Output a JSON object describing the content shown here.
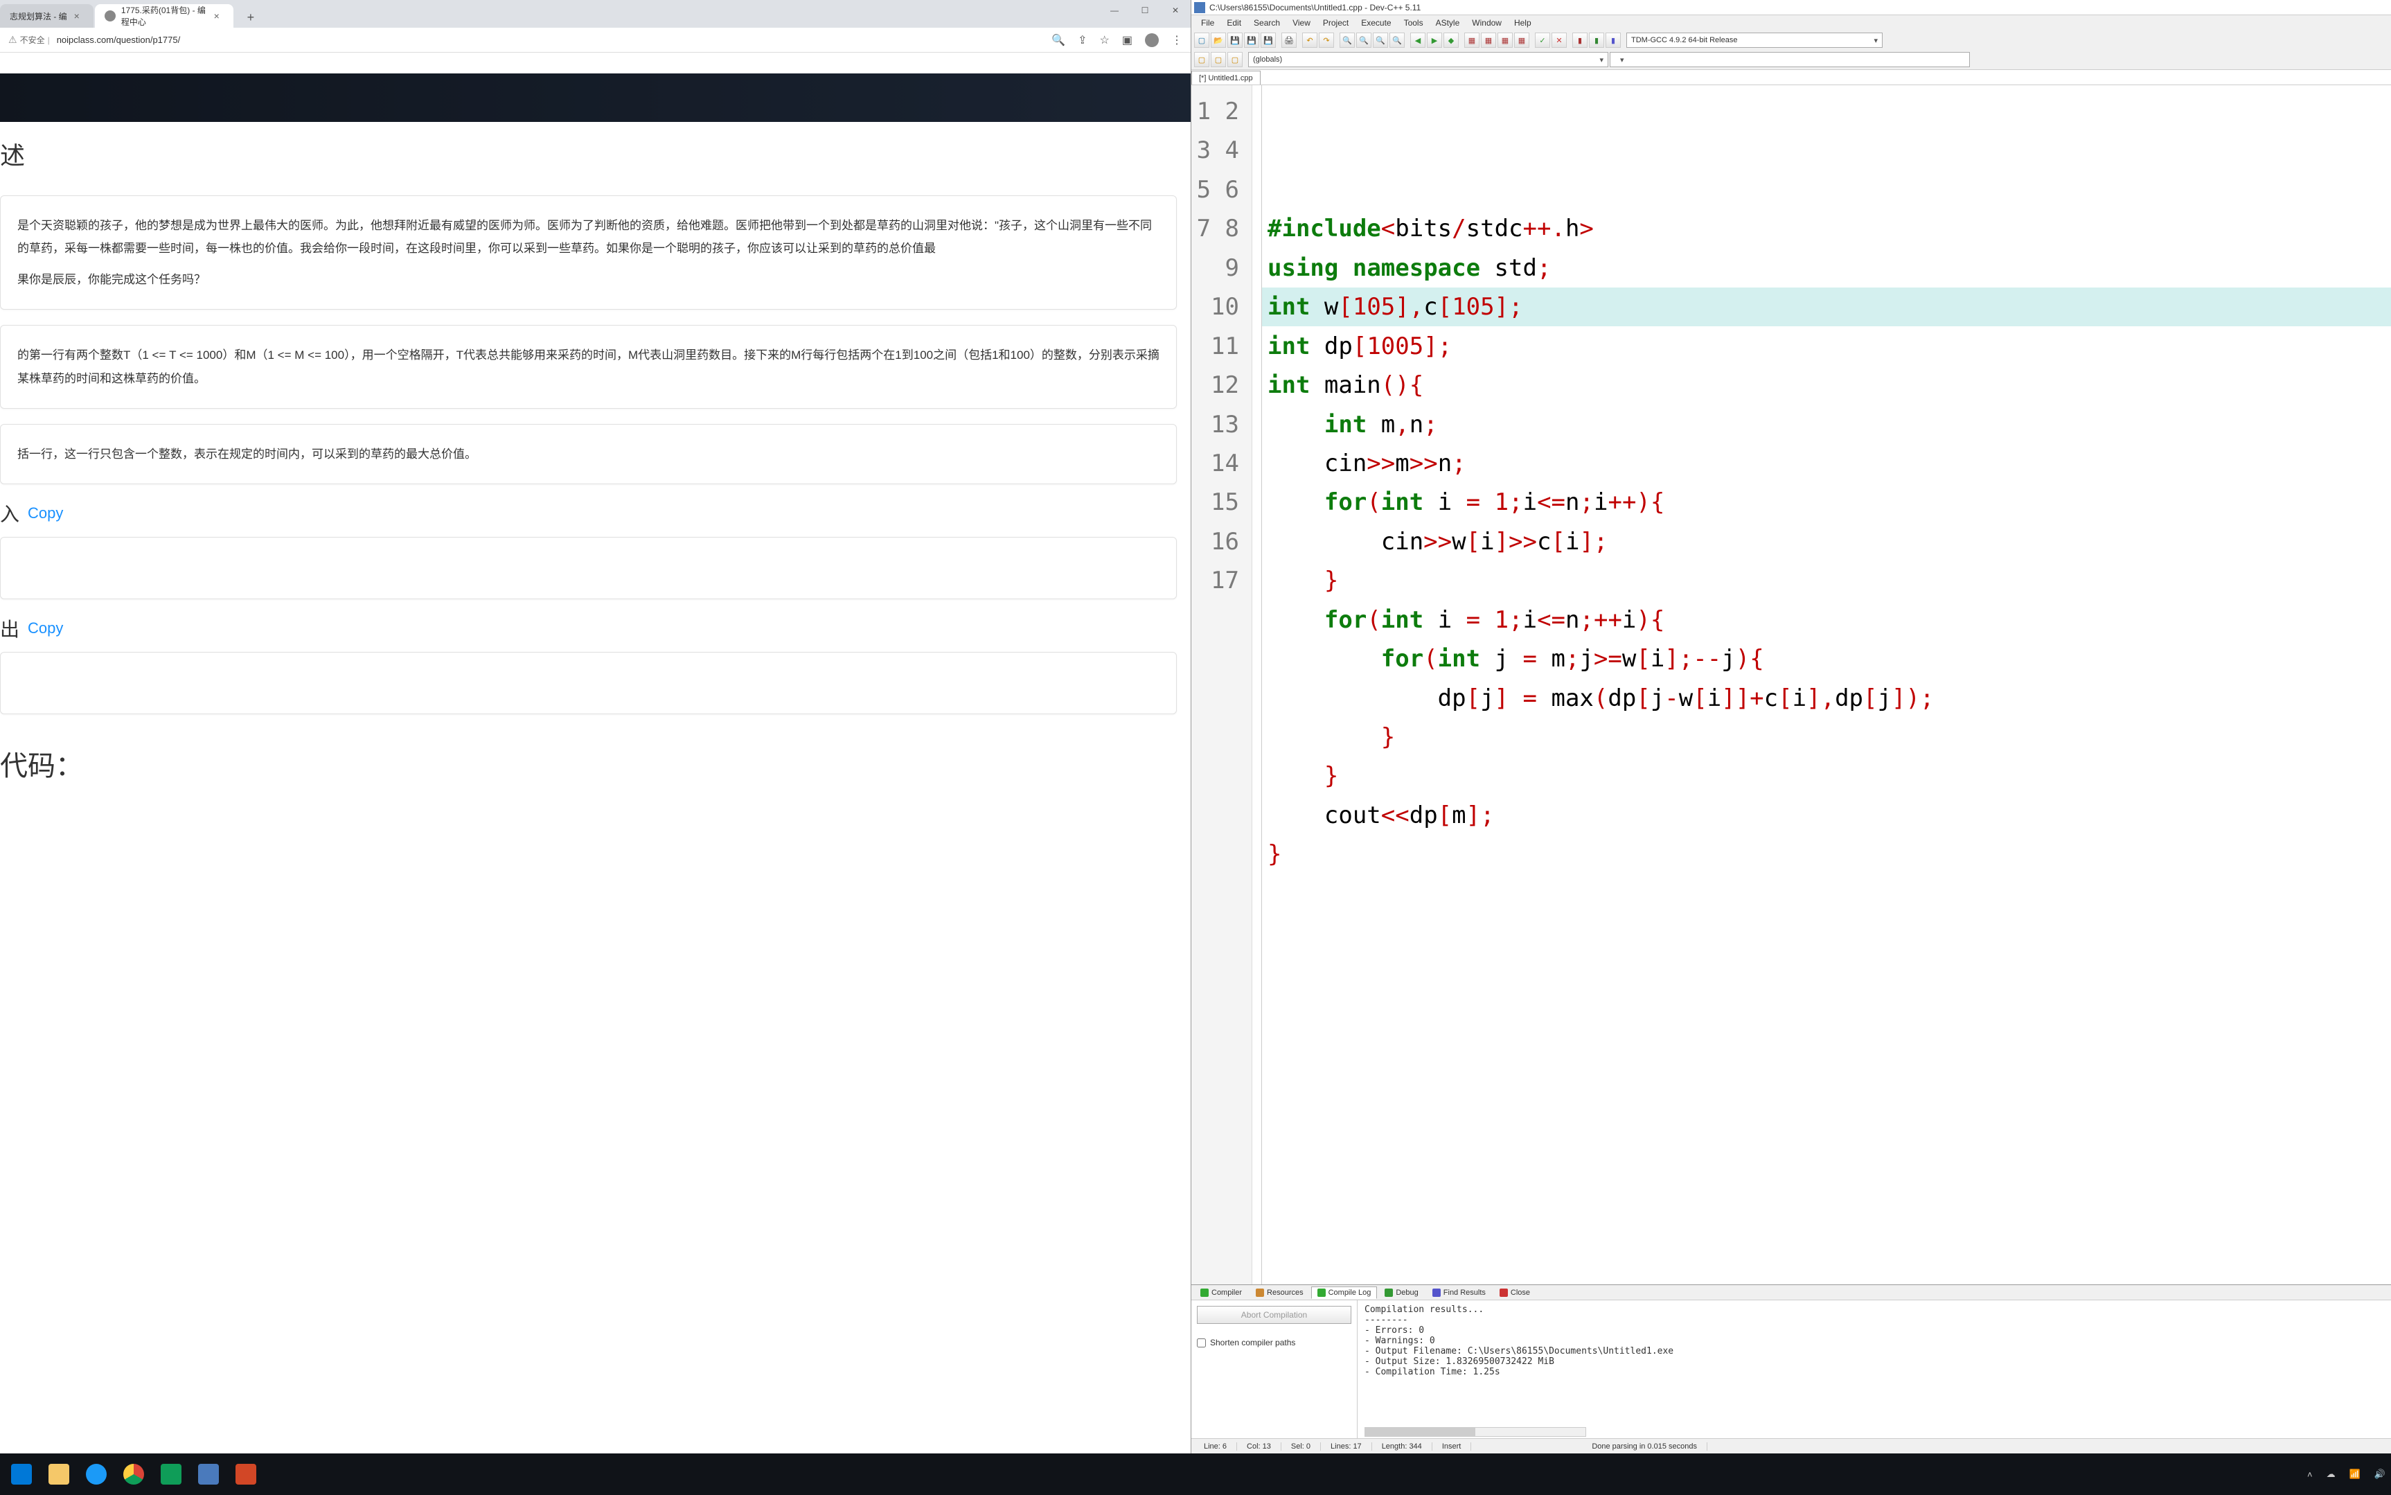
{
  "browser": {
    "tabs": [
      {
        "title": "志规划算法 - 编",
        "active": false
      },
      {
        "title": "1775.采药(01背包) - 编程中心",
        "active": true
      }
    ],
    "secure_text": "不安全",
    "url": "noipclass.com/question/p1775/",
    "sections": {
      "desc_heading": "述",
      "desc_body": "是个天资聪颖的孩子，他的梦想是成为世界上最伟大的医师。为此，他想拜附近最有威望的医师为师。医师为了判断他的资质，给他难题。医师把他带到一个到处都是草药的山洞里对他说：\"孩子，这个山洞里有一些不同的草药，采每一株都需要一些时间，每一株也的价值。我会给你一段时间，在这段时间里，你可以采到一些草药。如果你是一个聪明的孩子，你应该可以让采到的草药的总价值最",
      "desc_body2": "果你是辰辰，你能完成这个任务吗？",
      "input_body": "的第一行有两个整数T（1 <= T <= 1000）和M（1 <= M <= 100），用一个空格隔开，T代表总共能够用来采药的时间，M代表山洞里药数目。接下来的M行每行包括两个在1到100之间（包括1和100）的整数，分别表示采摘某株草药的时间和这株草药的价值。",
      "output_body": "括一行，这一行只包含一个整数，表示在规定的时间内，可以采到的草药的最大总价值。",
      "sample_in_head": "入",
      "sample_out_head": "出",
      "code_head": "代码：",
      "copy": "Copy"
    }
  },
  "devcpp": {
    "title": "C:\\Users\\86155\\Documents\\Untitled1.cpp - Dev-C++ 5.11",
    "menu": [
      "File",
      "Edit",
      "Search",
      "View",
      "Project",
      "Execute",
      "Tools",
      "AStyle",
      "Window",
      "Help"
    ],
    "globals_select": "(globals)",
    "compiler_select": "TDM-GCC 4.9.2 64-bit Release",
    "file_tab": "[*] Untitled1.cpp",
    "code_lines": 17,
    "highlighted_line": 6,
    "bottom_tabs": [
      {
        "label": "Compiler",
        "active": false
      },
      {
        "label": "Resources",
        "active": false
      },
      {
        "label": "Compile Log",
        "active": true
      },
      {
        "label": "Debug",
        "active": false
      },
      {
        "label": "Find Results",
        "active": false
      },
      {
        "label": "Close",
        "active": false
      }
    ],
    "abort_btn": "Abort Compilation",
    "shorten_paths": "Shorten compiler paths",
    "output": "Compilation results...\n--------\n- Errors: 0\n- Warnings: 0\n- Output Filename: C:\\Users\\86155\\Documents\\Untitled1.exe\n- Output Size: 1.83269500732422 MiB\n- Compilation Time: 1.25s",
    "status": {
      "line": "Line:   6",
      "col": "Col:   13",
      "sel": "Sel:   0",
      "lines": "Lines:   17",
      "length": "Length:   344",
      "insert": "Insert",
      "done": "Done parsing in 0.015 seconds"
    }
  },
  "taskbar": {
    "time": ""
  }
}
